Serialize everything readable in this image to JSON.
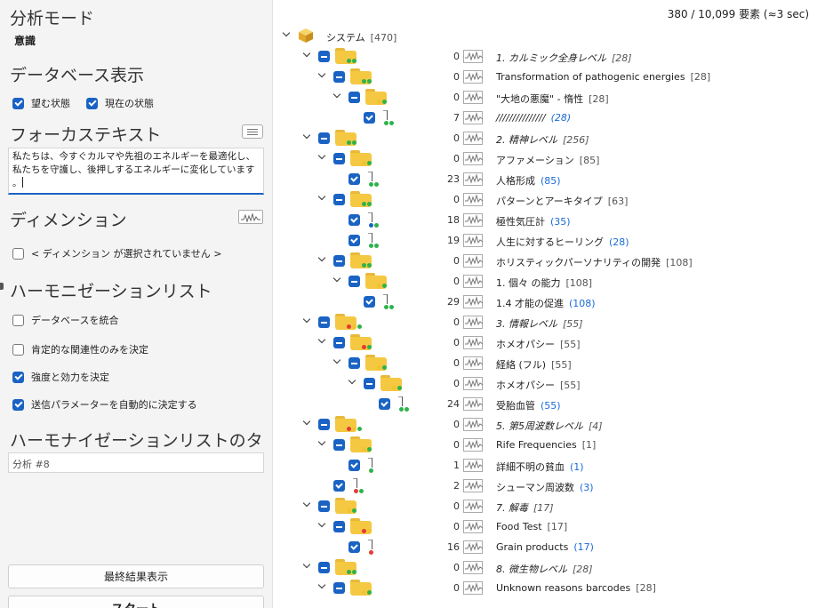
{
  "left": {
    "analysis_mode_title": "分析モード",
    "analysis_mode_value": "意識",
    "database_display_title": "データベース表示",
    "desired_state": {
      "label": "望む状態",
      "checked": true
    },
    "current_state": {
      "label": "現在の状態",
      "checked": true
    },
    "focus_text_title": "フォーカステキスト",
    "focus_text_value": "私たちは、今すぐカルマや先祖のエネルギーを最適化し、\n私たちを守護し、後押しするエネルギーに変化しています\n。",
    "dimension_title": "ディメンション",
    "dimension_empty": "< ディメンション が選択されていません >",
    "harmonization_list_title": "ハーモニゼーションリスト",
    "options": [
      {
        "label": "データベースを統合",
        "checked": false
      },
      {
        "label": "肯定的な関連性のみを決定",
        "checked": false
      },
      {
        "label": "強度と効力を決定",
        "checked": true
      },
      {
        "label": "送信パラメーターを自動的に決定する",
        "checked": true
      }
    ],
    "list_title_heading": "ハーモナイゼーションリストのタイトル",
    "list_title_value": "分析 #8",
    "show_final_button": "最終結果表示",
    "start_button": "スタート"
  },
  "tree": {
    "status": "380 / 10,099 要素 (≈3 sec)",
    "root": {
      "label": "システム",
      "count": "[470]"
    },
    "colors": {
      "green": "#2db34a",
      "red": "#e53935",
      "yellow": "#f2c230",
      "blue": "#1a63c4"
    },
    "rows": [
      {
        "kind": "folder",
        "lvl": 1,
        "count": "0",
        "label": "1. カルミック全身レベル",
        "n": "[28]",
        "italic": true,
        "dots": [
          "green",
          "green"
        ]
      },
      {
        "kind": "folder",
        "lvl": 2,
        "count": "0",
        "label": "Transformation of pathogenic energies",
        "n": "[28]",
        "italic": false,
        "dots": [
          "green",
          "green"
        ]
      },
      {
        "kind": "folder",
        "lvl": 3,
        "count": "0",
        "label": "\"大地の悪魔\" - 惰性",
        "n": "[28]",
        "italic": false,
        "dots": [
          "yellow",
          "green"
        ]
      },
      {
        "kind": "item",
        "lvl": 4,
        "count": "7",
        "label": "///////////////",
        "n": "(28)",
        "italic": true,
        "dots": [
          "green",
          "green"
        ]
      },
      {
        "kind": "folder",
        "lvl": 1,
        "count": "0",
        "label": "2. 精神レベル",
        "n": "[256]",
        "italic": true,
        "dots": [
          "green",
          "green"
        ]
      },
      {
        "kind": "folder",
        "lvl": 2,
        "count": "0",
        "label": "アファメーション",
        "n": "[85]",
        "italic": false,
        "dots": [
          "yellow",
          "green"
        ]
      },
      {
        "kind": "item",
        "lvl": 3,
        "count": "23",
        "label": "人格形成",
        "n": "(85)",
        "italic": false,
        "dots": [
          "green",
          "green"
        ]
      },
      {
        "kind": "folder",
        "lvl": 2,
        "count": "0",
        "label": "パターンとアーキタイプ",
        "n": "[63]",
        "italic": false,
        "dots": [
          "green",
          "green"
        ]
      },
      {
        "kind": "item",
        "lvl": 3,
        "count": "18",
        "label": "極性気圧計",
        "n": "(35)",
        "italic": false,
        "dots": [
          "blue",
          "green"
        ]
      },
      {
        "kind": "item",
        "lvl": 3,
        "count": "19",
        "label": "人生に対するヒーリング",
        "n": "(28)",
        "italic": false,
        "dots": [
          "green",
          "green"
        ]
      },
      {
        "kind": "folder",
        "lvl": 2,
        "count": "0",
        "label": "ホリスティックパーソナリティの開発",
        "n": "[108]",
        "italic": false,
        "dots": [
          "green",
          "green"
        ]
      },
      {
        "kind": "folder",
        "lvl": 3,
        "count": "0",
        "label": "1. 個々 の能力",
        "n": "[108]",
        "italic": false,
        "dots": [
          "yellow",
          "green"
        ]
      },
      {
        "kind": "item",
        "lvl": 4,
        "count": "29",
        "label": "1.4 才能の促進",
        "n": "(108)",
        "italic": false,
        "dots": [
          "green",
          "green"
        ]
      },
      {
        "kind": "folder",
        "lvl": 1,
        "count": "0",
        "label": "3. 情報レベル",
        "n": "[55]",
        "italic": true,
        "dots": [
          "red",
          "yellow",
          "green"
        ]
      },
      {
        "kind": "folder",
        "lvl": 2,
        "count": "0",
        "label": "ホメオパシー",
        "n": "[55]",
        "italic": false,
        "dots": [
          "red",
          "green"
        ]
      },
      {
        "kind": "folder",
        "lvl": 3,
        "count": "0",
        "label": "経絡 (フル)",
        "n": "[55]",
        "italic": false,
        "dots": [
          "yellow",
          "green"
        ]
      },
      {
        "kind": "folder",
        "lvl": 4,
        "count": "0",
        "label": "ホメオパシー",
        "n": "[55]",
        "italic": false,
        "dots": [
          "yellow",
          "green"
        ]
      },
      {
        "kind": "item",
        "lvl": 5,
        "count": "24",
        "label": "受胎血管",
        "n": "(55)",
        "italic": false,
        "dots": [
          "green",
          "green"
        ]
      },
      {
        "kind": "folder",
        "lvl": 1,
        "count": "0",
        "label": "5. 第5周波数レベル",
        "n": "[4]",
        "italic": true,
        "dots": [
          "red",
          "yellow",
          "green"
        ]
      },
      {
        "kind": "folder",
        "lvl": 2,
        "count": "0",
        "label": "Rife Frequencies",
        "n": "[1]",
        "italic": false,
        "dots": [
          "yellow",
          "green"
        ]
      },
      {
        "kind": "item",
        "lvl": 3,
        "count": "1",
        "label": "詳細不明の貧血",
        "n": "(1)",
        "italic": false,
        "dots": [
          "green"
        ]
      },
      {
        "kind": "item",
        "lvl": 2,
        "count": "2",
        "label": "シューマン周波数",
        "n": "(3)",
        "italic": false,
        "dots": [
          "red",
          "green"
        ]
      },
      {
        "kind": "folder",
        "lvl": 1,
        "count": "0",
        "label": "7. 解毒",
        "n": "[17]",
        "italic": true,
        "dots": [
          "yellow",
          "green"
        ]
      },
      {
        "kind": "folder",
        "lvl": 2,
        "count": "0",
        "label": "Food Test",
        "n": "[17]",
        "italic": false,
        "dots": [
          "red",
          "yellow"
        ]
      },
      {
        "kind": "item",
        "lvl": 3,
        "count": "16",
        "label": "Grain products",
        "n": "(17)",
        "italic": false,
        "dots": [
          "red"
        ]
      },
      {
        "kind": "folder",
        "lvl": 1,
        "count": "0",
        "label": "8. 微生物レベル",
        "n": "[28]",
        "italic": true,
        "dots": [
          "green",
          "green"
        ]
      },
      {
        "kind": "folder",
        "lvl": 2,
        "count": "0",
        "label": "Unknown reasons barcodes",
        "n": "[28]",
        "italic": false,
        "dots": [
          "yellow",
          "green"
        ]
      }
    ]
  }
}
